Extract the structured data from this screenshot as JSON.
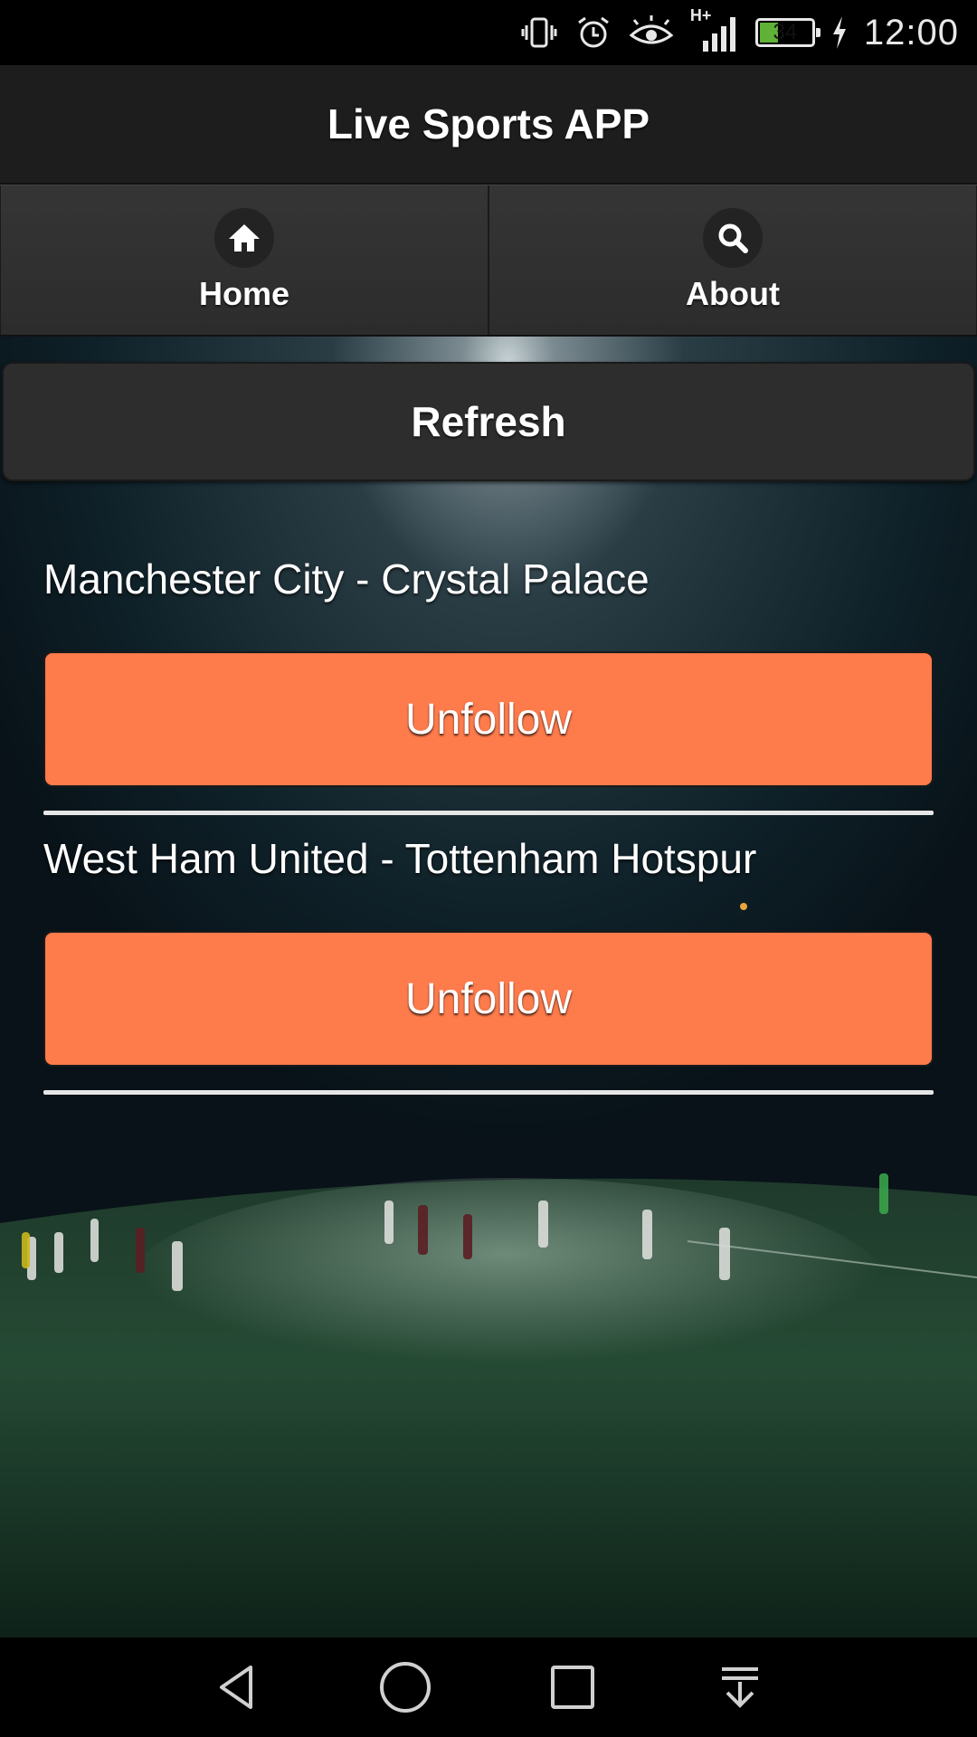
{
  "status_bar": {
    "battery_level": "34",
    "network_type": "H+",
    "time": "12:00",
    "icons": [
      "vibrate-icon",
      "alarm-icon",
      "eye-icon",
      "signal-icon",
      "battery-icon",
      "charging-icon"
    ]
  },
  "header": {
    "title": "Live Sports APP"
  },
  "nav": {
    "tabs": [
      {
        "label": "Home",
        "icon": "home-icon"
      },
      {
        "label": "About",
        "icon": "search-icon"
      }
    ]
  },
  "toolbar": {
    "refresh_label": "Refresh"
  },
  "matches": [
    {
      "title": "Manchester City - Crystal Palace",
      "action_label": "Unfollow"
    },
    {
      "title": "West Ham United - Tottenham Hotspur",
      "action_label": "Unfollow"
    }
  ],
  "colors": {
    "accent": "#fe7b4c",
    "header_bg": "#1d1d1d",
    "nav_bg": "#2f2f2f"
  },
  "system_nav": {
    "icons": [
      "back-icon",
      "home-circle-icon",
      "recents-icon",
      "notifications-pull-icon"
    ]
  }
}
